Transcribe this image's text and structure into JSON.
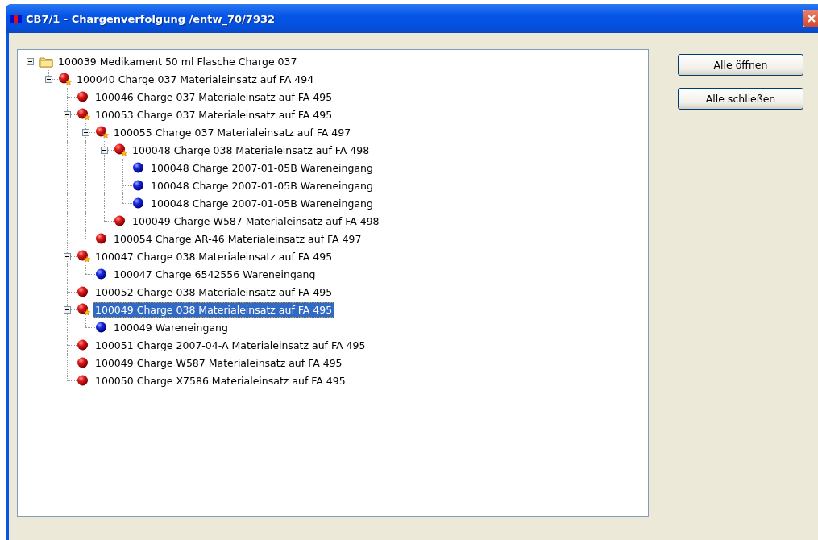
{
  "window": {
    "title": "CB7/1 - Chargenverfolgung /entw_70/7932"
  },
  "tree": [
    {
      "label": "100039 Medikament 50 ml Flasche Charge 037",
      "kind": "folder",
      "expanded": true,
      "selected": false,
      "children": [
        {
          "label": "100040 Charge 037 Materialeinsatz auf FA 494",
          "kind": "material-star",
          "expanded": true,
          "selected": false,
          "children": [
            {
              "label": "100046 Charge 037 Materialeinsatz auf FA 495",
              "kind": "material",
              "selected": false
            },
            {
              "label": "100053 Charge 037 Materialeinsatz auf FA 495",
              "kind": "material-star",
              "expanded": true,
              "selected": false,
              "children": [
                {
                  "label": "100055 Charge 037 Materialeinsatz auf FA 497",
                  "kind": "material-star",
                  "expanded": true,
                  "selected": false,
                  "children": [
                    {
                      "label": "100048 Charge 038 Materialeinsatz auf FA 498",
                      "kind": "material-star",
                      "expanded": true,
                      "selected": false,
                      "children": [
                        {
                          "label": "100048 Charge 2007-01-05B Wareneingang",
                          "kind": "receipt",
                          "selected": false
                        },
                        {
                          "label": "100048 Charge 2007-01-05B Wareneingang",
                          "kind": "receipt",
                          "selected": false
                        },
                        {
                          "label": "100048 Charge 2007-01-05B Wareneingang",
                          "kind": "receipt",
                          "selected": false
                        }
                      ]
                    },
                    {
                      "label": "100049 Charge W587 Materialeinsatz auf FA 498",
                      "kind": "material",
                      "selected": false
                    }
                  ]
                },
                {
                  "label": "100054 Charge AR-46 Materialeinsatz auf FA 497",
                  "kind": "material",
                  "selected": false
                }
              ]
            },
            {
              "label": "100047 Charge 038 Materialeinsatz auf FA 495",
              "kind": "material-star",
              "expanded": true,
              "selected": false,
              "children": [
                {
                  "label": "100047 Charge 6542556 Wareneingang",
                  "kind": "receipt",
                  "selected": false
                }
              ]
            },
            {
              "label": "100052 Charge 038 Materialeinsatz auf FA 495",
              "kind": "material",
              "selected": false
            },
            {
              "label": "100049 Charge 038 Materialeinsatz auf FA 495",
              "kind": "material-star",
              "expanded": true,
              "selected": true,
              "children": [
                {
                  "label": "100049 Wareneingang",
                  "kind": "receipt",
                  "selected": false
                }
              ]
            },
            {
              "label": "100051 Charge 2007-04-A Materialeinsatz auf FA 495",
              "kind": "material",
              "selected": false
            },
            {
              "label": "100049 Charge W587 Materialeinsatz auf FA 495",
              "kind": "material",
              "selected": false
            },
            {
              "label": "100050 Charge X7586 Materialeinsatz auf FA 495",
              "kind": "material",
              "selected": false
            }
          ]
        }
      ]
    }
  ],
  "buttons": [
    "Alle öffnen",
    "Alle schließen"
  ]
}
